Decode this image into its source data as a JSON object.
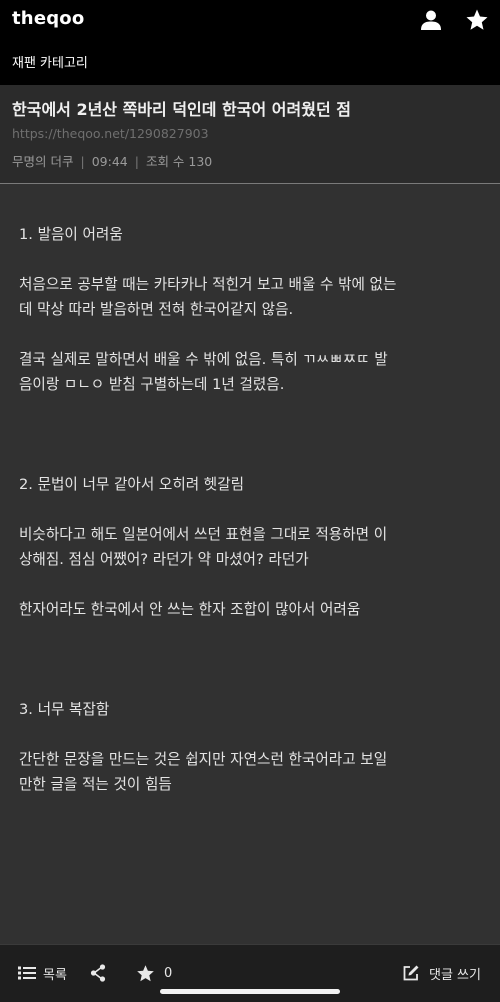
{
  "app": {
    "logo": "theqoo",
    "category": "재팬 카테고리"
  },
  "post": {
    "title": "한국에서 2년산 쪽바리 덕인데 한국어 어려웠던 점",
    "url": "https://theqoo.net/1290827903",
    "author": "무명의 더쿠",
    "time": "09:44",
    "views_label": "조회 수 130"
  },
  "content": {
    "lines": [
      "1. 발음이 어려움",
      "",
      "처음으로 공부할 때는 카타카나 적힌거 보고 배울 수 밖에 없는",
      "데 막상 따라 발음하면 전혀 한국어같지 않음.",
      "",
      "결국 실제로 말하면서 배울 수 밖에 없음. 특히 ㄲㅆㅃㅉㄸ 발",
      "음이랑 ㅁㄴㅇ 받침 구별하는데 1년 걸렸음.",
      "",
      "",
      "",
      "2. 문법이 너무 같아서 오히려 헷갈림",
      "",
      "비슷하다고 해도 일본어에서 쓰던 표현을 그대로 적용하면 이",
      "상해짐. 점심 어쨌어? 라던가 약 마셨어? 라던가",
      "",
      "한자어라도 한국에서 안 쓰는 한자 조합이 많아서 어려움",
      "",
      "",
      "",
      "3.  너무 복잡함",
      "",
      "간단한 문장을 만드는 것은 쉽지만 자연스런 한국어라고 보일",
      "만한 글을 적는 것이 힘듬"
    ]
  },
  "bottom_bar": {
    "list_label": "목록",
    "star_count": "0",
    "comment_label": "댓글 쓰기"
  },
  "icons": {
    "user": "user-icon",
    "star": "star-icon",
    "list": "list-icon",
    "share": "share-icon",
    "write": "write-icon"
  }
}
